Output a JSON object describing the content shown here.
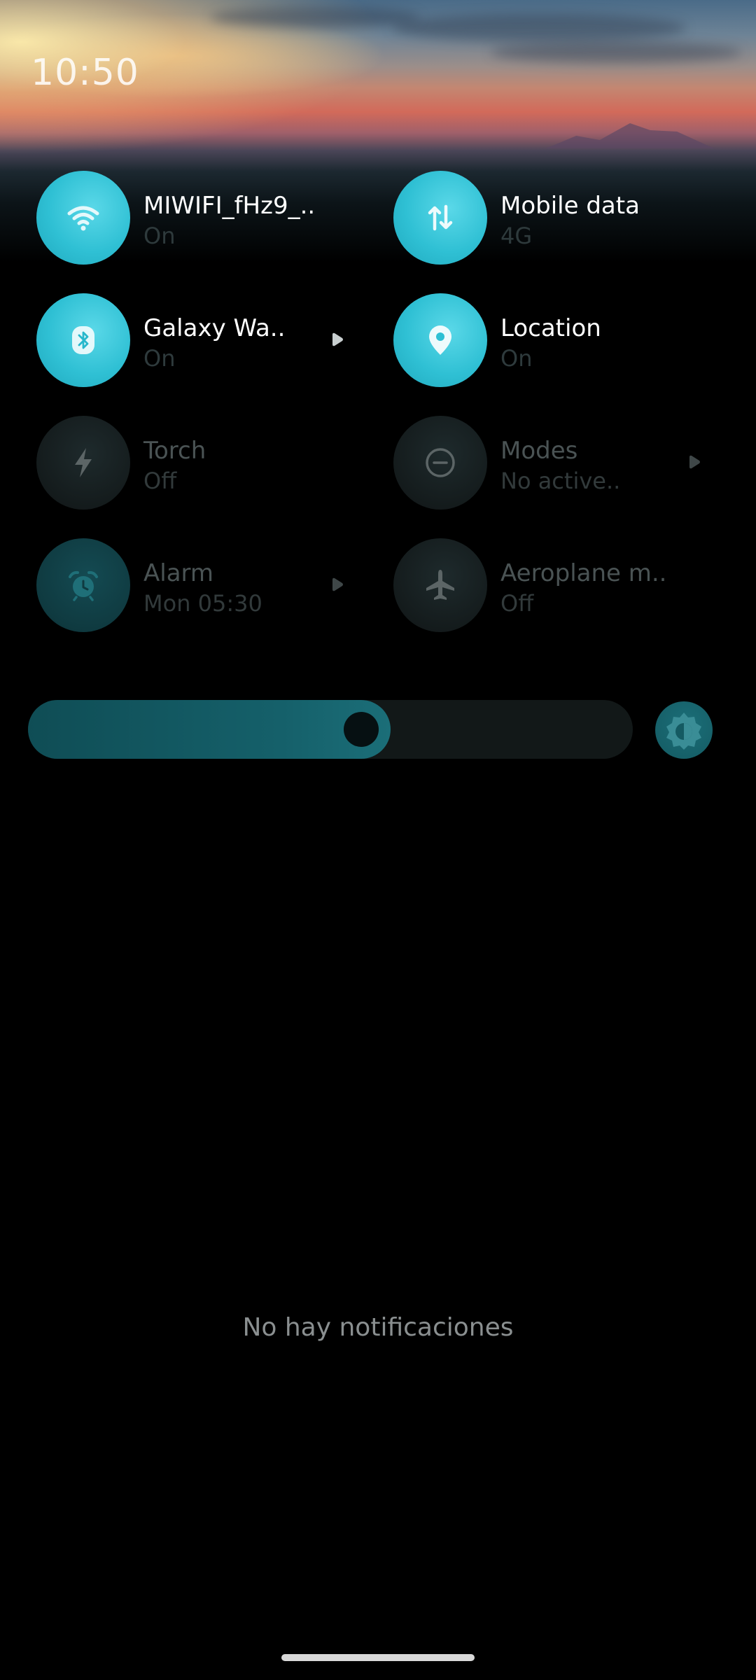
{
  "status": {
    "time": "10:50"
  },
  "tiles": [
    {
      "title": "MIWIFI_fHz9_..",
      "subtitle": "On",
      "icon": "wifi-icon",
      "state": "on"
    },
    {
      "title": "Mobile data",
      "subtitle": "4G",
      "icon": "mobile-data-icon",
      "state": "on"
    },
    {
      "title": "Galaxy Wa..",
      "subtitle": "On",
      "icon": "bluetooth-icon",
      "state": "on"
    },
    {
      "title": "Location",
      "subtitle": "On",
      "icon": "location-icon",
      "state": "on"
    },
    {
      "title": "Torch",
      "subtitle": "Off",
      "icon": "torch-icon",
      "state": "off"
    },
    {
      "title": "Modes",
      "subtitle": "No active..",
      "icon": "modes-icon",
      "state": "off"
    },
    {
      "title": "Alarm",
      "subtitle": "Mon 05:30",
      "icon": "alarm-icon",
      "state": "dim"
    },
    {
      "title": "Aeroplane m..",
      "subtitle": "Off",
      "icon": "airplane-icon",
      "state": "off"
    }
  ],
  "brightness": {
    "level_percent": 60,
    "auto_icon": "brightness-auto-icon"
  },
  "notifications": {
    "empty_text": "No hay notificaciones"
  },
  "colors": {
    "accent": "#2fc0d4",
    "background": "#000000"
  }
}
